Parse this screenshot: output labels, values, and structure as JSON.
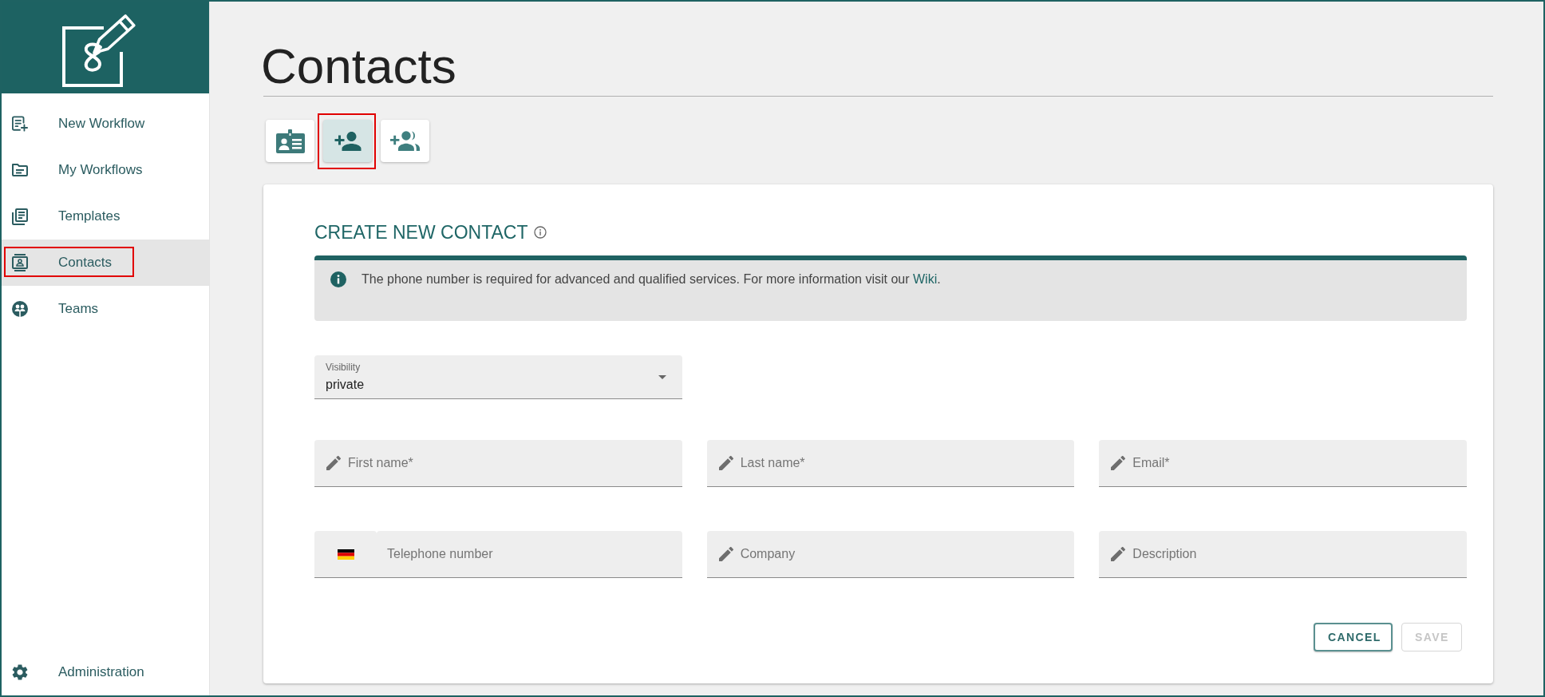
{
  "sidebar": {
    "items": [
      {
        "label": "New Workflow",
        "selected": false,
        "highlighted": false
      },
      {
        "label": "My Workflows",
        "selected": false,
        "highlighted": false
      },
      {
        "label": "Templates",
        "selected": false,
        "highlighted": false
      },
      {
        "label": "Contacts",
        "selected": true,
        "highlighted": true
      },
      {
        "label": "Teams",
        "selected": false,
        "highlighted": false
      }
    ],
    "bottom_items": [
      {
        "label": "Administration",
        "selected": false,
        "highlighted": false
      }
    ]
  },
  "page": {
    "title": "Contacts"
  },
  "toolbar": {
    "buttons": [
      {
        "selected": false,
        "highlighted": false
      },
      {
        "selected": true,
        "highlighted": true
      },
      {
        "selected": false,
        "highlighted": false
      }
    ]
  },
  "form": {
    "title": "CREATE NEW CONTACT",
    "notice": {
      "text": "The phone number is required for advanced and qualified services. For more information visit our",
      "link": "Wiki",
      "text_end": "."
    },
    "visibility": {
      "label": "Visibility",
      "value": "private"
    },
    "fields": [
      {
        "kind": "text",
        "placeholder": "First name*"
      },
      {
        "kind": "text",
        "placeholder": "Last name*"
      },
      {
        "kind": "text",
        "placeholder": "Email*"
      },
      {
        "kind": "phone",
        "placeholder": "Telephone number"
      },
      {
        "kind": "text",
        "placeholder": "Company"
      },
      {
        "kind": "text",
        "placeholder": "Description"
      }
    ],
    "actions": [
      {
        "label": "CANCEL",
        "disabled": false
      },
      {
        "label": "SAVE",
        "disabled": true
      }
    ]
  }
}
